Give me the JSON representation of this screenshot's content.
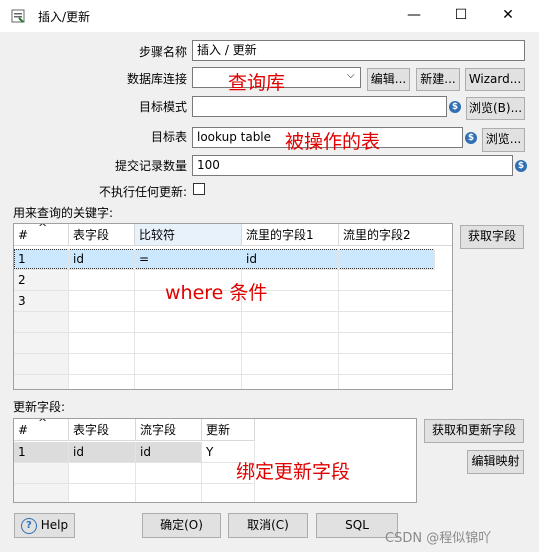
{
  "window": {
    "title": "插入/更新",
    "minimize": "—",
    "maximize": "☐",
    "close": "✕"
  },
  "form": {
    "step_name_label": "步骤名称",
    "step_name_value": "插入 / 更新",
    "db_conn_label": "数据库连接",
    "db_conn_value": "",
    "db_edit_btn": "编辑...",
    "db_new_btn": "新建...",
    "db_wizard_btn": "Wizard...",
    "schema_label": "目标模式",
    "schema_value": "",
    "schema_browse_btn": "浏览(B)...",
    "table_label": "目标表",
    "table_value": "lookup table",
    "table_browse_btn": "浏览...",
    "commit_label": "提交记录数量",
    "commit_value": "100",
    "no_update_label": "不执行任何更新:",
    "no_update_checked": false
  },
  "key_section": {
    "label": "用来查询的关键字:",
    "get_fields_btn": "获取字段",
    "columns": [
      "#",
      "表字段",
      "比较符",
      "流里的字段1",
      "流里的字段2"
    ],
    "rows": [
      [
        "1",
        "id",
        "=",
        "id",
        ""
      ],
      [
        "2",
        "",
        "",
        "",
        ""
      ],
      [
        "3",
        "",
        "",
        "",
        ""
      ]
    ]
  },
  "update_section": {
    "label": "更新字段:",
    "get_update_btn": "获取和更新字段",
    "edit_mapping_btn": "编辑映射",
    "columns": [
      "#",
      "表字段",
      "流字段",
      "更新"
    ],
    "rows": [
      [
        "1",
        "id",
        "id",
        "Y"
      ]
    ]
  },
  "annotations": {
    "db": "查询库",
    "table": "被操作的表",
    "where": "where 条件",
    "bind": "绑定更新字段"
  },
  "footer": {
    "help_btn": "Help",
    "ok_btn": "确定(O)",
    "cancel_btn": "取消(C)",
    "sql_btn": "SQL",
    "watermark": "CSDN @程似锦吖"
  },
  "colors": {
    "annotation": "#e00000",
    "selected_row": "#cce8ff",
    "accent": "#2f6fb5"
  }
}
